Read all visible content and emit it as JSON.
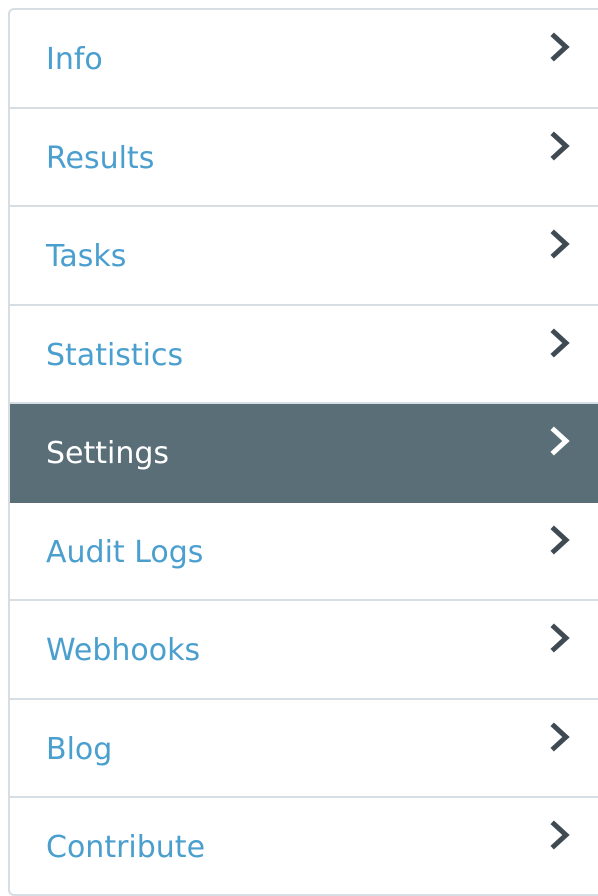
{
  "nav": {
    "items": [
      {
        "label": "Info",
        "active": false,
        "icon": "chevron-right-icon"
      },
      {
        "label": "Results",
        "active": false,
        "icon": "chevron-right-icon"
      },
      {
        "label": "Tasks",
        "active": false,
        "icon": "chevron-right-icon"
      },
      {
        "label": "Statistics",
        "active": false,
        "icon": "chevron-right-icon"
      },
      {
        "label": "Settings",
        "active": true,
        "icon": "chevron-right-icon"
      },
      {
        "label": "Audit Logs",
        "active": false,
        "icon": "chevron-right-icon"
      },
      {
        "label": "Webhooks",
        "active": false,
        "icon": "chevron-right-icon"
      },
      {
        "label": "Blog",
        "active": false,
        "icon": "chevron-right-icon"
      },
      {
        "label": "Contribute",
        "active": false,
        "icon": "chevron-right-icon"
      }
    ]
  },
  "colors": {
    "link": "#4a9fcf",
    "active_bg": "#5a6e78",
    "active_text": "#ffffff",
    "chevron": "#3f4a52",
    "border": "#d6dee3"
  }
}
